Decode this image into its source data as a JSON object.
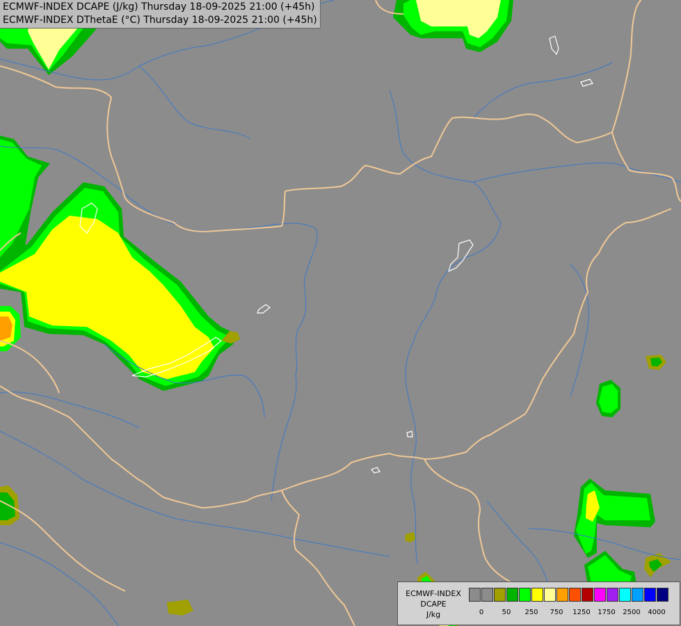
{
  "title": {
    "line1": "ECMWF-INDEX DCAPE (J/kg) Thursday 18-09-2025 21:00 (+45h)",
    "line2": "ECMWF-INDEX DThetaE (°C) Thursday 18-09-2025 21:00 (+45h)"
  },
  "legend": {
    "line1": "ECMWF-INDEX",
    "line2": "DCAPE",
    "line3": "J/kg",
    "colors": [
      "#8c8c8c",
      "#8c8c8c",
      "#a0a000",
      "#00b400",
      "#00ff00",
      "#ffff00",
      "#ffff96",
      "#ffa000",
      "#ff5000",
      "#b40000",
      "#ff00ff",
      "#a020f0",
      "#00ffff",
      "#00a0ff",
      "#0000ff",
      "#000080"
    ],
    "ticks": [
      "0",
      "50",
      "250",
      "750",
      "1250",
      "1750",
      "2500",
      "4000"
    ]
  },
  "map_colors": {
    "background": "#8c8c8c",
    "border": "#f0c896",
    "river": "#3c78c8",
    "lake": "#ffffff"
  }
}
